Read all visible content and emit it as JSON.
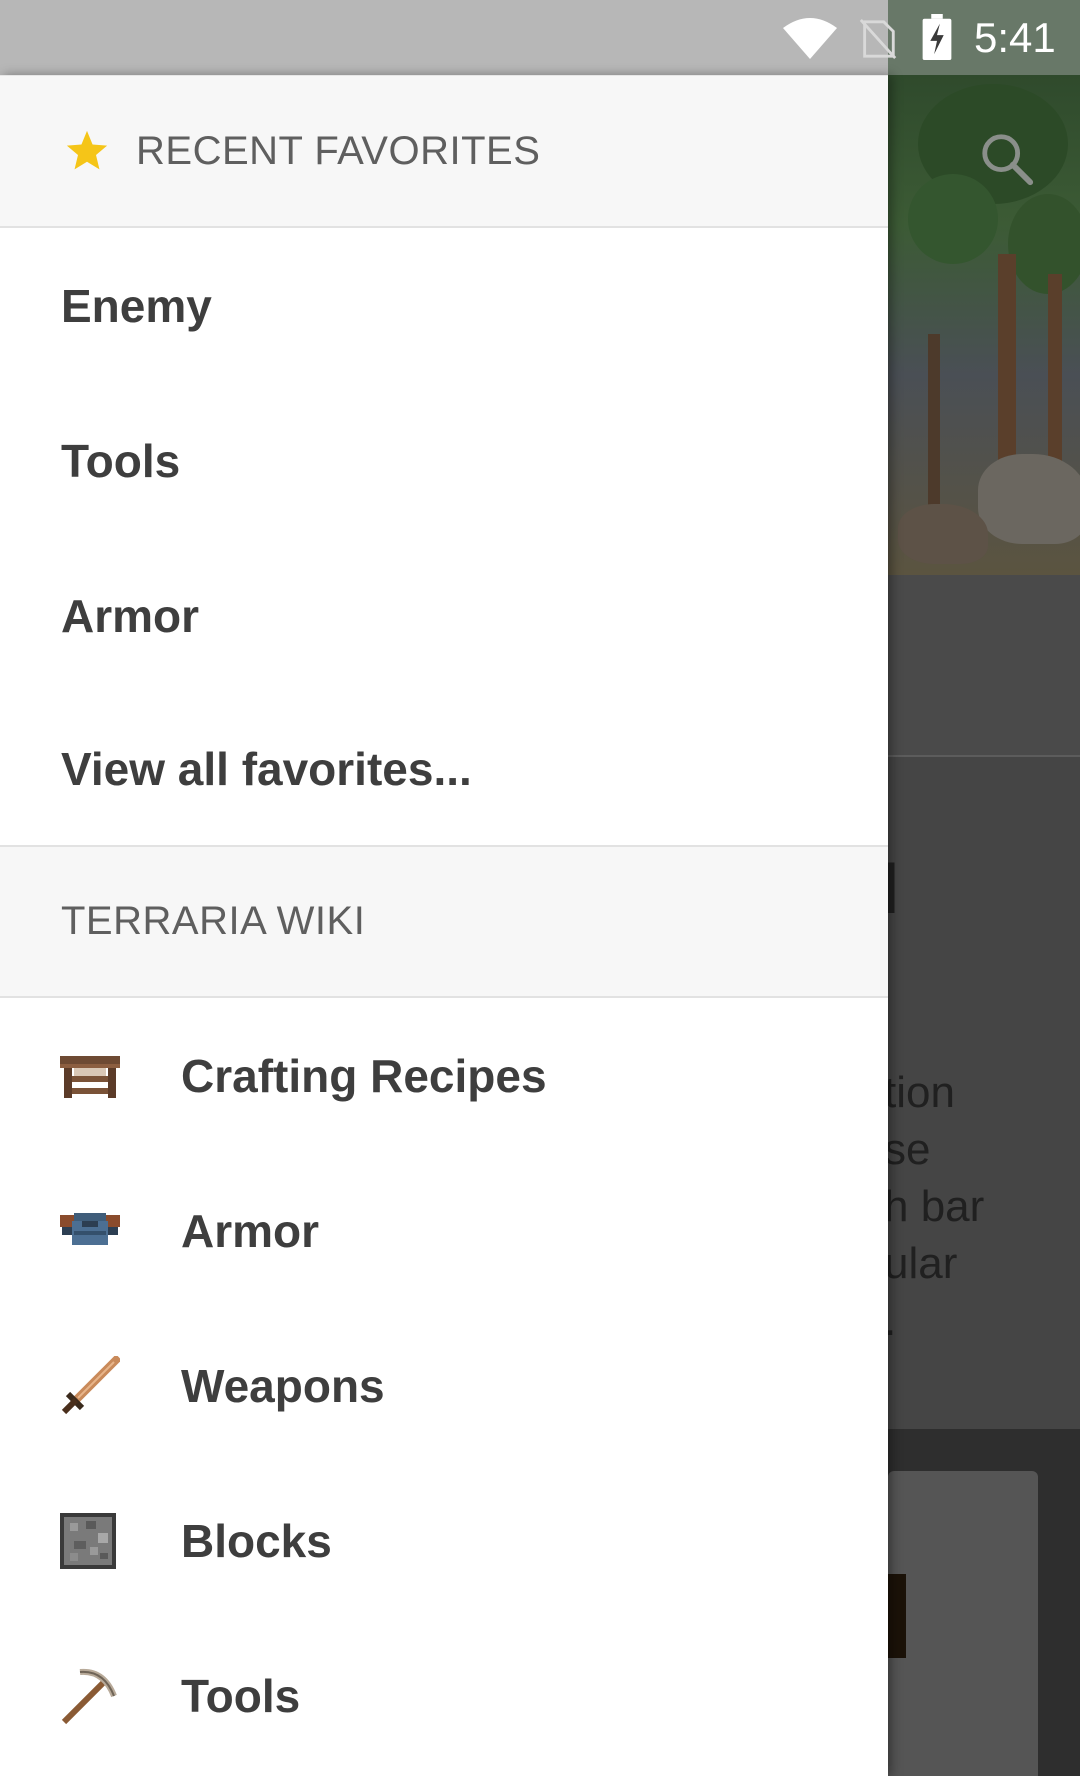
{
  "status_bar": {
    "time": "5:41",
    "icons": [
      "wifi-icon",
      "no-sim-icon",
      "battery-charging-icon"
    ]
  },
  "background": {
    "visible_fragments": [
      "l",
      "tion",
      "se",
      "h bar",
      "ular",
      "."
    ]
  },
  "drawer": {
    "favorites_header": {
      "label": "RECENT FAVORITES",
      "icon": "star-icon",
      "icon_color": "#f5c518"
    },
    "favorites": [
      {
        "label": "Enemy"
      },
      {
        "label": "Tools"
      },
      {
        "label": "Armor"
      },
      {
        "label": "View all favorites..."
      }
    ],
    "wiki_header": {
      "label": "TERRARIA WIKI"
    },
    "wiki_items": [
      {
        "label": "Crafting Recipes",
        "icon": "crafting-table-icon"
      },
      {
        "label": "Armor",
        "icon": "armor-icon"
      },
      {
        "label": "Weapons",
        "icon": "sword-icon"
      },
      {
        "label": "Blocks",
        "icon": "stone-block-icon"
      },
      {
        "label": "Tools",
        "icon": "pickaxe-icon"
      }
    ]
  }
}
